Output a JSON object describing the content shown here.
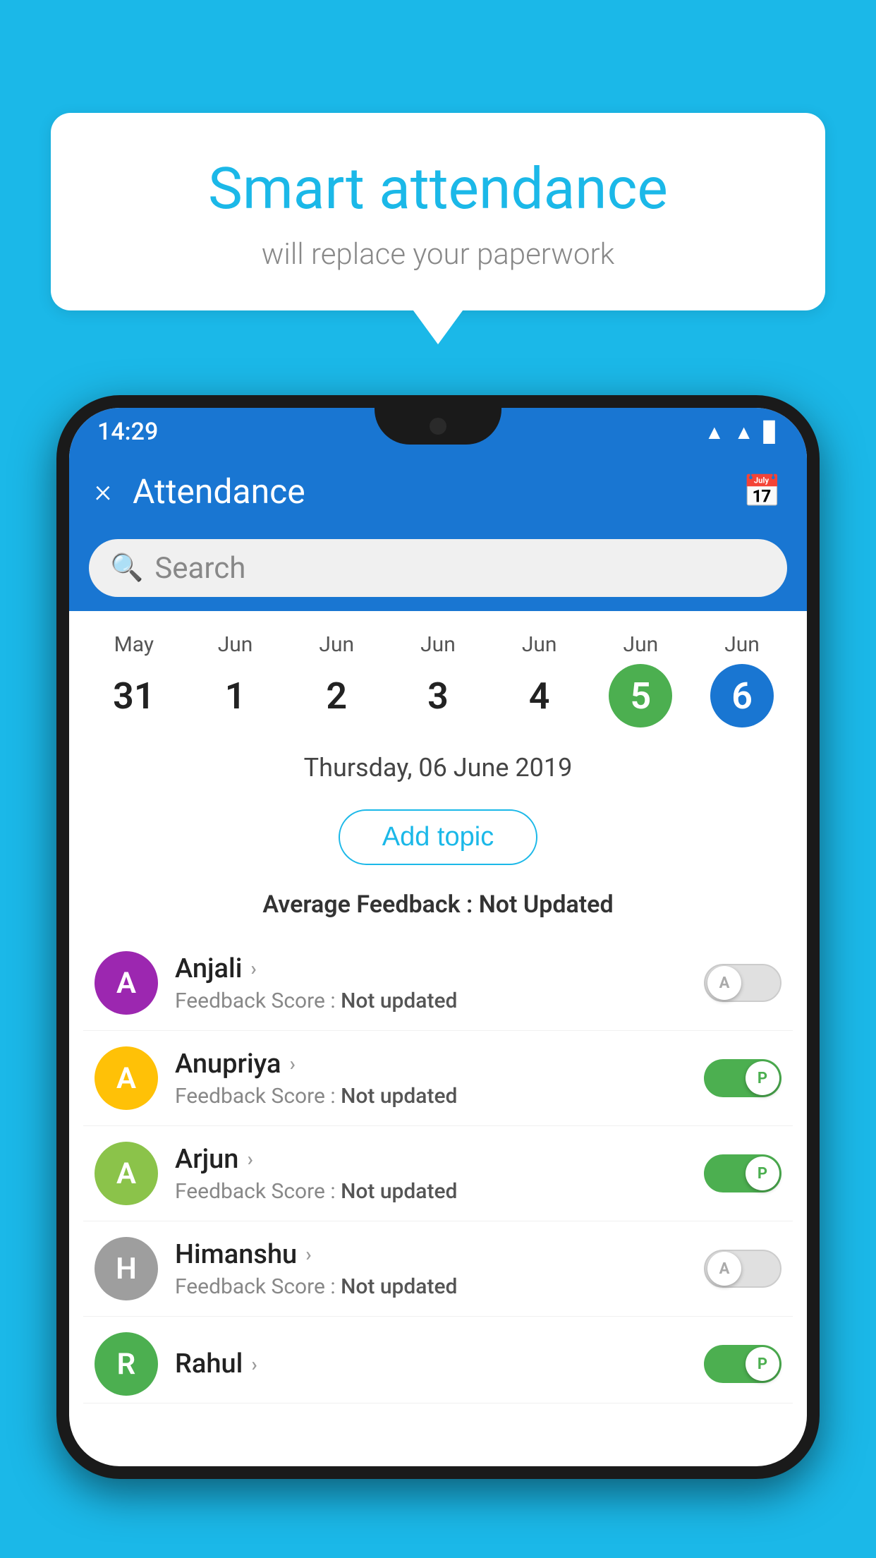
{
  "background_color": "#1BB8E8",
  "bubble": {
    "title": "Smart attendance",
    "subtitle": "will replace your paperwork"
  },
  "status_bar": {
    "time": "14:29",
    "icons": [
      "wifi",
      "signal",
      "battery"
    ]
  },
  "app_bar": {
    "title": "Attendance",
    "close_icon": "×",
    "calendar_icon": "📅"
  },
  "search": {
    "placeholder": "Search"
  },
  "calendar": {
    "days": [
      {
        "month": "May",
        "date": "31",
        "state": "normal"
      },
      {
        "month": "Jun",
        "date": "1",
        "state": "normal"
      },
      {
        "month": "Jun",
        "date": "2",
        "state": "normal"
      },
      {
        "month": "Jun",
        "date": "3",
        "state": "normal"
      },
      {
        "month": "Jun",
        "date": "4",
        "state": "normal"
      },
      {
        "month": "Jun",
        "date": "5",
        "state": "today"
      },
      {
        "month": "Jun",
        "date": "6",
        "state": "selected"
      }
    ]
  },
  "selected_date": "Thursday, 06 June 2019",
  "add_topic_label": "Add topic",
  "avg_feedback": {
    "label": "Average Feedback : ",
    "value": "Not Updated"
  },
  "students": [
    {
      "name": "Anjali",
      "avatar_letter": "A",
      "avatar_color": "#9C27B0",
      "feedback_label": "Feedback Score : ",
      "feedback_value": "Not updated",
      "attendance": "absent"
    },
    {
      "name": "Anupriya",
      "avatar_letter": "A",
      "avatar_color": "#FFC107",
      "feedback_label": "Feedback Score : ",
      "feedback_value": "Not updated",
      "attendance": "present"
    },
    {
      "name": "Arjun",
      "avatar_letter": "A",
      "avatar_color": "#8BC34A",
      "feedback_label": "Feedback Score : ",
      "feedback_value": "Not updated",
      "attendance": "present"
    },
    {
      "name": "Himanshu",
      "avatar_letter": "H",
      "avatar_color": "#9E9E9E",
      "feedback_label": "Feedback Score : ",
      "feedback_value": "Not updated",
      "attendance": "absent"
    }
  ],
  "partial_student": {
    "name": "Rahul",
    "avatar_letter": "R",
    "avatar_color": "#4CAF50",
    "attendance": "present"
  }
}
